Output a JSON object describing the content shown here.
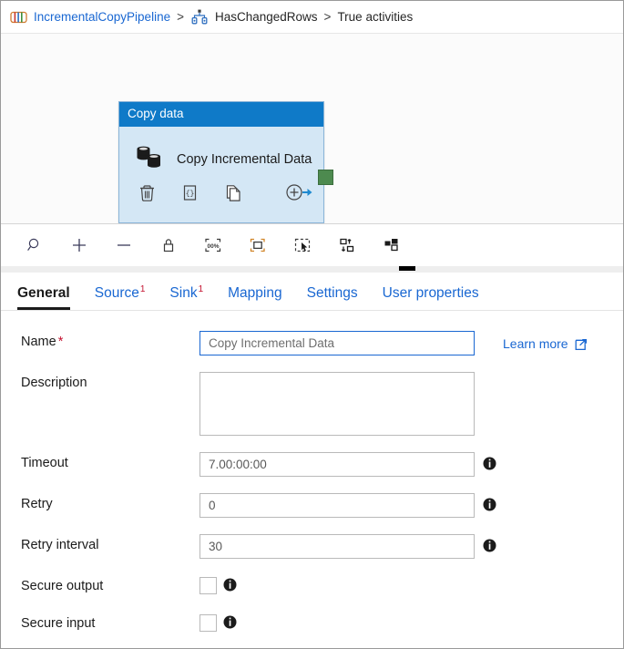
{
  "breadcrumb": {
    "pipeline_icon": "pipeline-icon",
    "pipeline_name": "IncrementalCopyPipeline",
    "separator1": ">",
    "condition_icon": "if-condition-icon",
    "condition_name": "HasChangedRows",
    "separator2": ">",
    "branch_name": "True activities"
  },
  "canvas": {
    "activity": {
      "header": "Copy data",
      "icon": "copy-data-icon",
      "title": "Copy Incremental Data",
      "actions": [
        {
          "name": "delete-activity-icon",
          "label": "Delete"
        },
        {
          "name": "code-view-icon",
          "label": "Code"
        },
        {
          "name": "clone-activity-icon",
          "label": "Clone"
        },
        {
          "name": "add-output-icon",
          "label": "Add output"
        }
      ],
      "output_port": "output-port"
    }
  },
  "toolbar": {
    "buttons": [
      {
        "name": "zoom-search-icon",
        "label": "Zoom"
      },
      {
        "name": "zoom-in-icon",
        "label": "Zoom in"
      },
      {
        "name": "zoom-out-icon",
        "label": "Zoom out"
      },
      {
        "name": "lock-icon",
        "label": "Lock canvas"
      },
      {
        "name": "zoom-100-icon",
        "label": "100%"
      },
      {
        "name": "zoom-to-fit-icon",
        "label": "Zoom to fit"
      },
      {
        "name": "select-mode-icon",
        "label": "Select"
      },
      {
        "name": "auto-align-vertical-icon",
        "label": "Auto align vertical"
      },
      {
        "name": "auto-align-horizontal-icon",
        "label": "Auto align horizontal"
      }
    ]
  },
  "tabs": [
    {
      "label": "General",
      "badge": "",
      "active": true
    },
    {
      "label": "Source",
      "badge": "1",
      "active": false
    },
    {
      "label": "Sink",
      "badge": "1",
      "active": false
    },
    {
      "label": "Mapping",
      "badge": "",
      "active": false
    },
    {
      "label": "Settings",
      "badge": "",
      "active": false
    },
    {
      "label": "User properties",
      "badge": "",
      "active": false
    }
  ],
  "form": {
    "name": {
      "label": "Name",
      "required": "*",
      "value": "Copy Incremental Data",
      "placeholder": "Name"
    },
    "description": {
      "label": "Description",
      "value": "",
      "placeholder": ""
    },
    "timeout": {
      "label": "Timeout",
      "value": "7.00:00:00",
      "placeholder": "7.00:00:00",
      "info_icon": "info-icon"
    },
    "retry": {
      "label": "Retry",
      "value": "0",
      "placeholder": "0",
      "info_icon": "info-icon"
    },
    "retry_interval": {
      "label": "Retry interval",
      "value": "30",
      "placeholder": "30",
      "info_icon": "info-icon"
    },
    "secure_output": {
      "label": "Secure output",
      "checked": false,
      "info_icon": "info-icon"
    },
    "secure_input": {
      "label": "Secure input",
      "checked": false,
      "info_icon": "info-icon"
    }
  },
  "learn_more": {
    "label": "Learn more",
    "icon": "external-link-icon"
  },
  "colors": {
    "accent_blue": "#1967d2",
    "card_header": "#0f7ac8",
    "card_body": "#d4e7f5",
    "required_red": "#c4122f",
    "output_port_green": "#4d8a4f"
  }
}
